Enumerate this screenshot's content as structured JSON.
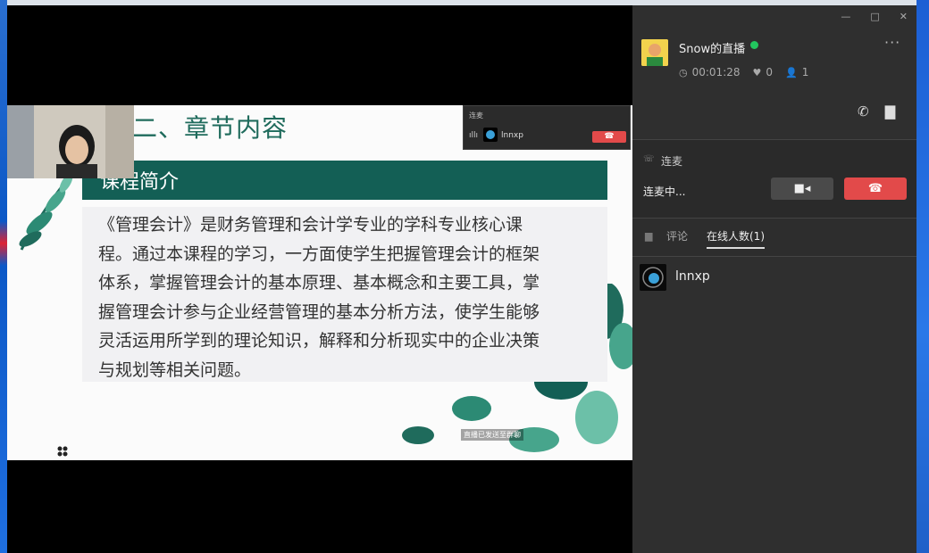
{
  "slide": {
    "title": "二、章节内容",
    "banner": "课程简介",
    "body": "《管理会计》是财务管理和会计学专业的学科专业核心课程。通过本课程的学习，一方面使学生把握管理会计的框架体系，掌握管理会计的基本原理、基本概念和主要工具，掌握管理会计参与企业经营管理的基本分析方法，使学生能够灵活运用所学到的理论知识，解释和分析现实中的企业决策与规划等相关问题。",
    "caption": "直播已发送至群聊"
  },
  "popup": {
    "title": "连麦",
    "user": "lnnxp",
    "hangup_icon": "phone-hangup-icon"
  },
  "panel": {
    "host_name": "Snow的直播",
    "duration": "00:01:28",
    "likes": "0",
    "viewers": "1",
    "lianmai_label": "连麦",
    "lianmai_status": "连麦中...",
    "tab_comment": "评论",
    "tab_online": "在线人数(1)",
    "online_users": [
      {
        "name": "lnnxp"
      }
    ]
  },
  "colors": {
    "accent_green": "#135f55",
    "hangup_red": "#e24a4a",
    "live_green": "#22c55e"
  }
}
